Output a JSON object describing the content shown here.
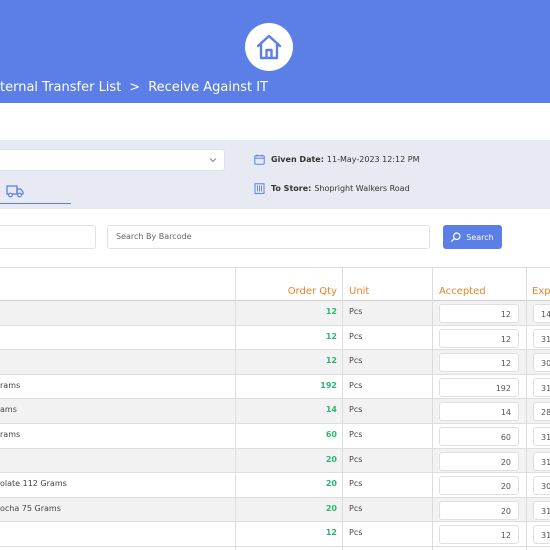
{
  "breadcrumb": {
    "parent": "ternal Transfer List",
    "separator": ">",
    "current": "Receive Against IT"
  },
  "details": {
    "given_date_label": "Given Date:",
    "given_date_value": "11-May-2023 12:12 PM",
    "to_store_label": "To Store:",
    "to_store_value": "Shopright Walkers Road"
  },
  "search": {
    "barcode_placeholder": "Search By Barcode",
    "button_label": "Search"
  },
  "table": {
    "headers": {
      "order_qty": "Order Qty",
      "unit": "Unit",
      "accepted": "Accepted",
      "expiry": "Expi"
    },
    "rows": [
      {
        "name": "",
        "order_qty": "12",
        "unit": "Pcs",
        "accepted": "12",
        "expiry": "14"
      },
      {
        "name": "",
        "order_qty": "12",
        "unit": "Pcs",
        "accepted": "12",
        "expiry": "31"
      },
      {
        "name": "",
        "order_qty": "12",
        "unit": "Pcs",
        "accepted": "12",
        "expiry": "30"
      },
      {
        "name": "rams",
        "order_qty": "192",
        "unit": "Pcs",
        "accepted": "192",
        "expiry": "31"
      },
      {
        "name": "ams",
        "order_qty": "14",
        "unit": "Pcs",
        "accepted": "14",
        "expiry": "28"
      },
      {
        "name": "rams",
        "order_qty": "60",
        "unit": "Pcs",
        "accepted": "60",
        "expiry": "31"
      },
      {
        "name": "",
        "order_qty": "20",
        "unit": "Pcs",
        "accepted": "20",
        "expiry": "31"
      },
      {
        "name": "olate 112 Grams",
        "order_qty": "20",
        "unit": "Pcs",
        "accepted": "20",
        "expiry": "30"
      },
      {
        "name": "ocha 75 Grams",
        "order_qty": "20",
        "unit": "Pcs",
        "accepted": "20",
        "expiry": "31"
      },
      {
        "name": "",
        "order_qty": "12",
        "unit": "Pcs",
        "accepted": "12",
        "expiry": "31"
      }
    ]
  },
  "colors": {
    "header_bg": "#5b7fe6",
    "accent_orange": "#e8842c",
    "qty_green": "#2bb673",
    "panel_bg": "#e7eaf2"
  },
  "icons": {
    "home": "home-icon",
    "truck": "truck-icon",
    "calendar": "calendar-icon",
    "store": "building-icon",
    "search": "search-icon",
    "chevron": "chevron-down-icon"
  }
}
